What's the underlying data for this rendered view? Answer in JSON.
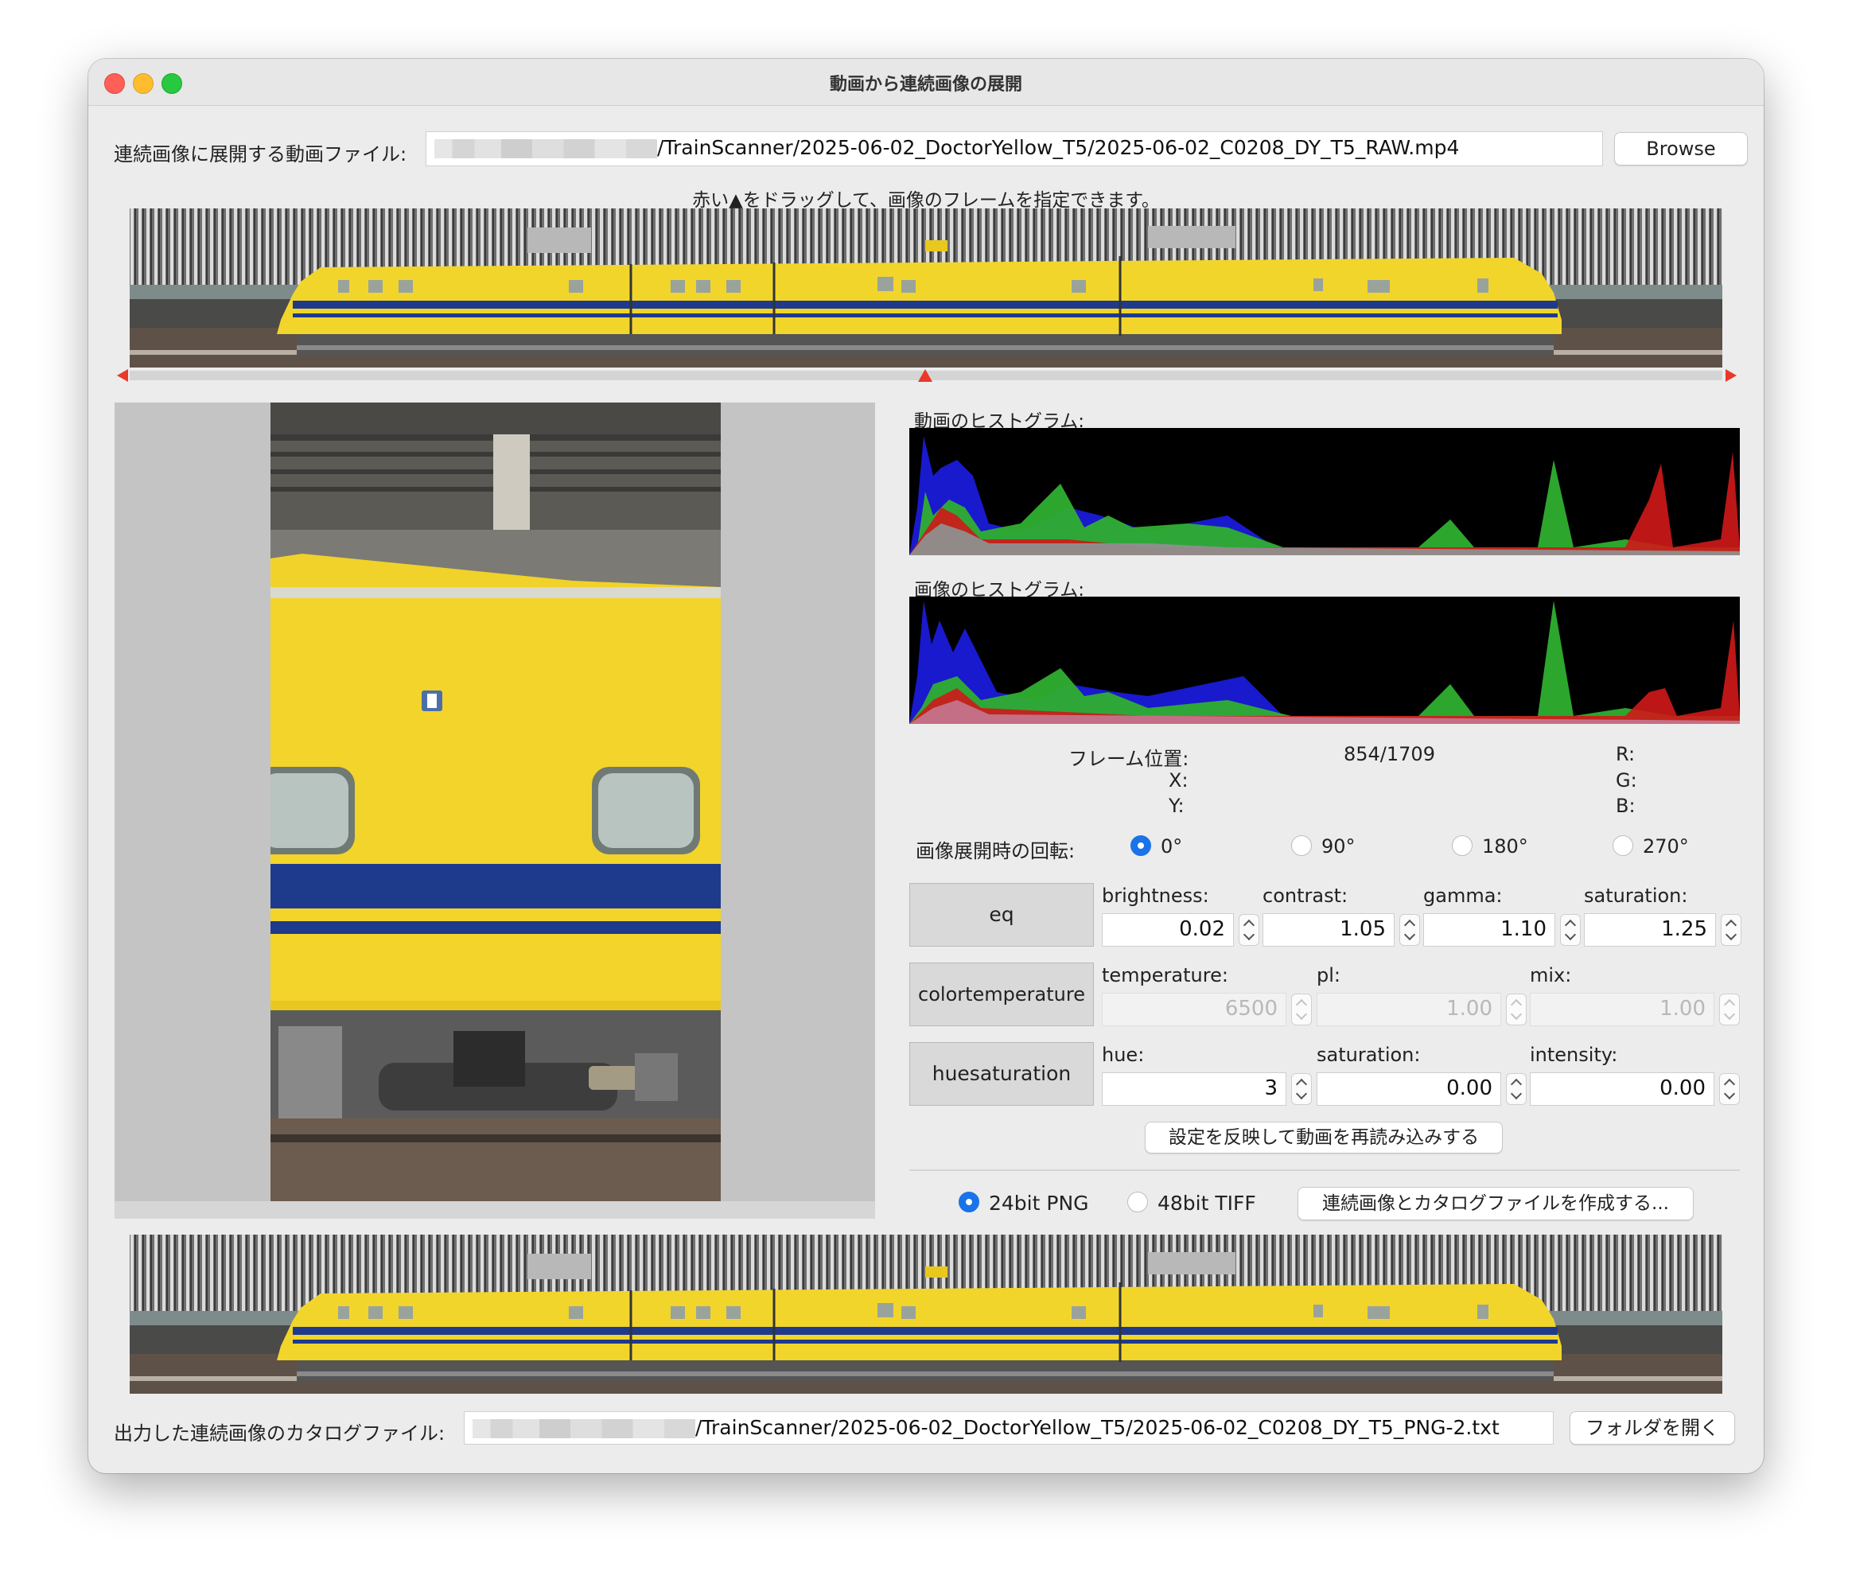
{
  "window": {
    "title": "動画から連続画像の展開"
  },
  "input_file": {
    "label": "連続画像に展開する動画ファイル:",
    "path": "/TrainScanner/2025-06-02_DoctorYellow_T5/2025-06-02_C0208_DY_T5_RAW.mp4",
    "browse_label": "Browse"
  },
  "hint": "赤い▲をドラッグして、画像のフレームを指定できます。",
  "histograms": {
    "movie_label": "動画のヒストグラム:",
    "image_label": "画像のヒストグラム:"
  },
  "info": {
    "frame_label": "フレーム位置:",
    "frame_value": "854/1709",
    "x_label": "X:",
    "y_label": "Y:",
    "r_label": "R:",
    "g_label": "G:",
    "b_label": "B:"
  },
  "rotation": {
    "label": "画像展開時の回転:",
    "options": [
      "0°",
      "90°",
      "180°",
      "270°"
    ],
    "selected": "0°"
  },
  "filters": {
    "eq": {
      "button": "eq",
      "fields": [
        {
          "label": "brightness:",
          "value": "0.02"
        },
        {
          "label": "contrast:",
          "value": "1.05"
        },
        {
          "label": "gamma:",
          "value": "1.10"
        },
        {
          "label": "saturation:",
          "value": "1.25"
        }
      ]
    },
    "colortemperature": {
      "button": "colortemperature",
      "fields": [
        {
          "label": "temperature:",
          "value": "6500"
        },
        {
          "label": "pl:",
          "value": "1.00"
        },
        {
          "label": "mix:",
          "value": "1.00"
        }
      ]
    },
    "huesaturation": {
      "button": "huesaturation",
      "fields": [
        {
          "label": "hue:",
          "value": "3"
        },
        {
          "label": "saturation:",
          "value": "0.00"
        },
        {
          "label": "intensity:",
          "value": "0.00"
        }
      ]
    },
    "reload_button": "設定を反映して動画を再読み込みする"
  },
  "output": {
    "formats": [
      "24bit PNG",
      "48bit TIFF"
    ],
    "selected": "24bit PNG",
    "create_button": "連続画像とカタログファイルを作成する..."
  },
  "catalog": {
    "label": "出力した連続画像のカタログファイル:",
    "path": "/TrainScanner/2025-06-02_DoctorYellow_T5/2025-06-02_C0208_DY_T5_PNG-2.txt",
    "open_button": "フォルダを開く"
  },
  "colors": {
    "train_yellow": "#f2d52a",
    "train_stripe": "#1f3a8c",
    "histogram_red": "#d01818",
    "histogram_green": "#2faf2f",
    "histogram_blue": "#1a1ad8",
    "accent": "#1a73e8",
    "marker_red": "#e8392a"
  },
  "frame_slider": {
    "position": 0.4997
  }
}
